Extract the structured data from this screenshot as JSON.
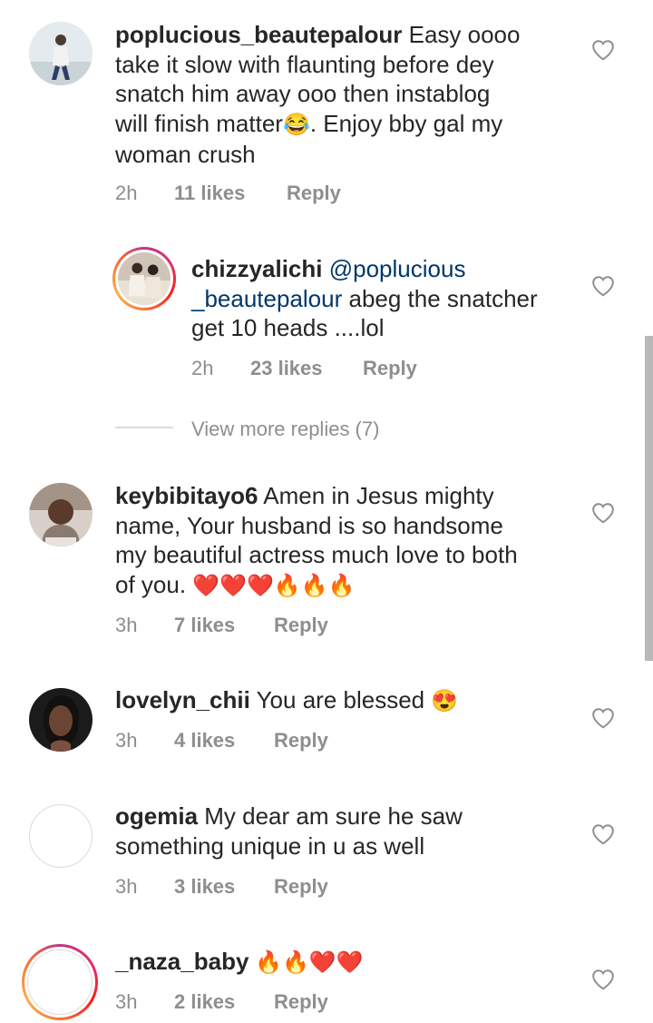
{
  "comments": [
    {
      "username": "poplucious_beautepalour",
      "text_lines": [
        "Easy oooo",
        "take it slow with flaunting before dey",
        "snatch him away ooo then instablog",
        "will finish matter",
        ". Enjoy bby gal my",
        "woman crush"
      ],
      "emoji_inline": "😂",
      "time": "2h",
      "likes": "11 likes",
      "reply": "Reply",
      "avatar_icon": "avatar-photo"
    },
    {
      "username": "chizzyalichi",
      "mention": "@poplucious",
      "mention_cont": "_beautepalour",
      "text_after": " abeg the snatcher",
      "text_line3": "get 10 heads ....lol",
      "time": "2h",
      "likes": "23 likes",
      "reply": "Reply",
      "avatar_icon": "avatar-photo-story-ring"
    },
    {
      "username": "keybibitayo6",
      "text_line1": " Amen in Jesus mighty",
      "text_line2": "name, Your husband is so handsome",
      "text_line3": "my beautiful actress much love to both",
      "text_line4": "of you. ",
      "emojis": "❤️❤️❤️🔥🔥🔥",
      "time": "3h",
      "likes": "7 likes",
      "reply": "Reply",
      "avatar_icon": "avatar-photo"
    },
    {
      "username": "lovelyn_chii",
      "text": " You are blessed ",
      "emoji": "😍",
      "time": "3h",
      "likes": "4 likes",
      "reply": "Reply",
      "avatar_icon": "avatar-photo"
    },
    {
      "username": "ogemia",
      "text_line1": " My dear am sure he saw",
      "text_line2": "something unique in u as well",
      "time": "3h",
      "likes": "3 likes",
      "reply": "Reply",
      "avatar_icon": "avatar-empty"
    },
    {
      "username": "_naza_baby",
      "emojis": " 🔥🔥❤️❤️",
      "time": "3h",
      "likes": "2 likes",
      "reply": "Reply",
      "avatar_icon": "avatar-empty-story-ring"
    }
  ],
  "view_more_replies": "View more replies (7)",
  "colors": {
    "text": "#262626",
    "meta": "#8e8e8e",
    "mention": "#00376b",
    "divider": "#dbdbdb"
  },
  "icons": {
    "like": "heart-outline-icon"
  }
}
